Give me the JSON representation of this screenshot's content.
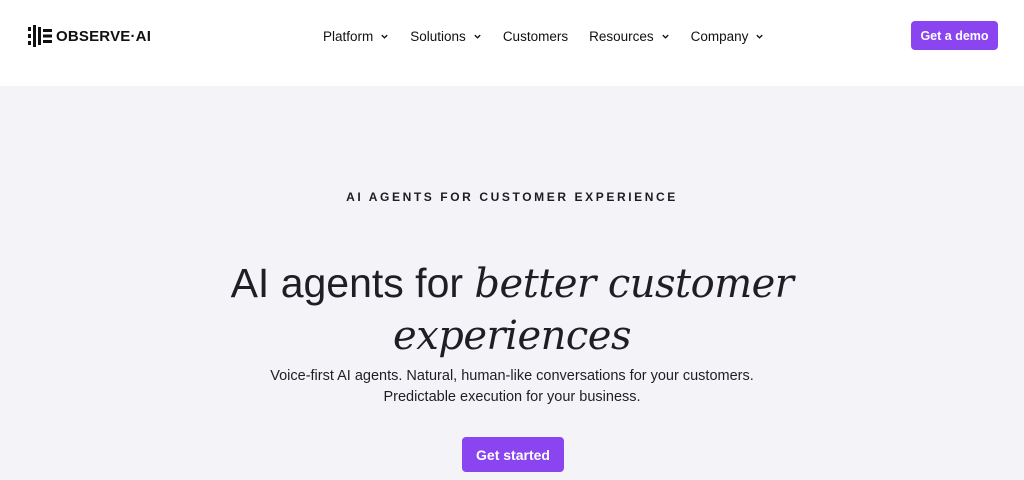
{
  "header": {
    "logo_text": "OBSERVE·AI",
    "nav": [
      {
        "label": "Platform",
        "has_menu": true
      },
      {
        "label": "Solutions",
        "has_menu": true
      },
      {
        "label": "Customers",
        "has_menu": false
      },
      {
        "label": "Resources",
        "has_menu": true
      },
      {
        "label": "Company",
        "has_menu": true
      }
    ],
    "demo_button": "Get a demo"
  },
  "hero": {
    "eyebrow": "AI AGENTS FOR CUSTOMER EXPERIENCE",
    "headline_plain": "AI agents for ",
    "headline_italic_1": "better customer",
    "headline_italic_2": "experiences",
    "subline_1": "Voice-first AI agents. Natural, human-like conversations for your customers.",
    "subline_2": "Predictable execution for your business.",
    "cta_button": "Get started"
  },
  "colors": {
    "accent": "#8a45f0",
    "hero_background": "#f4f3f8",
    "text": "#1e1e24"
  },
  "icons": {
    "logo": "observe-ai-logo-mark",
    "nav_dropdown": "chevron-down-icon"
  }
}
